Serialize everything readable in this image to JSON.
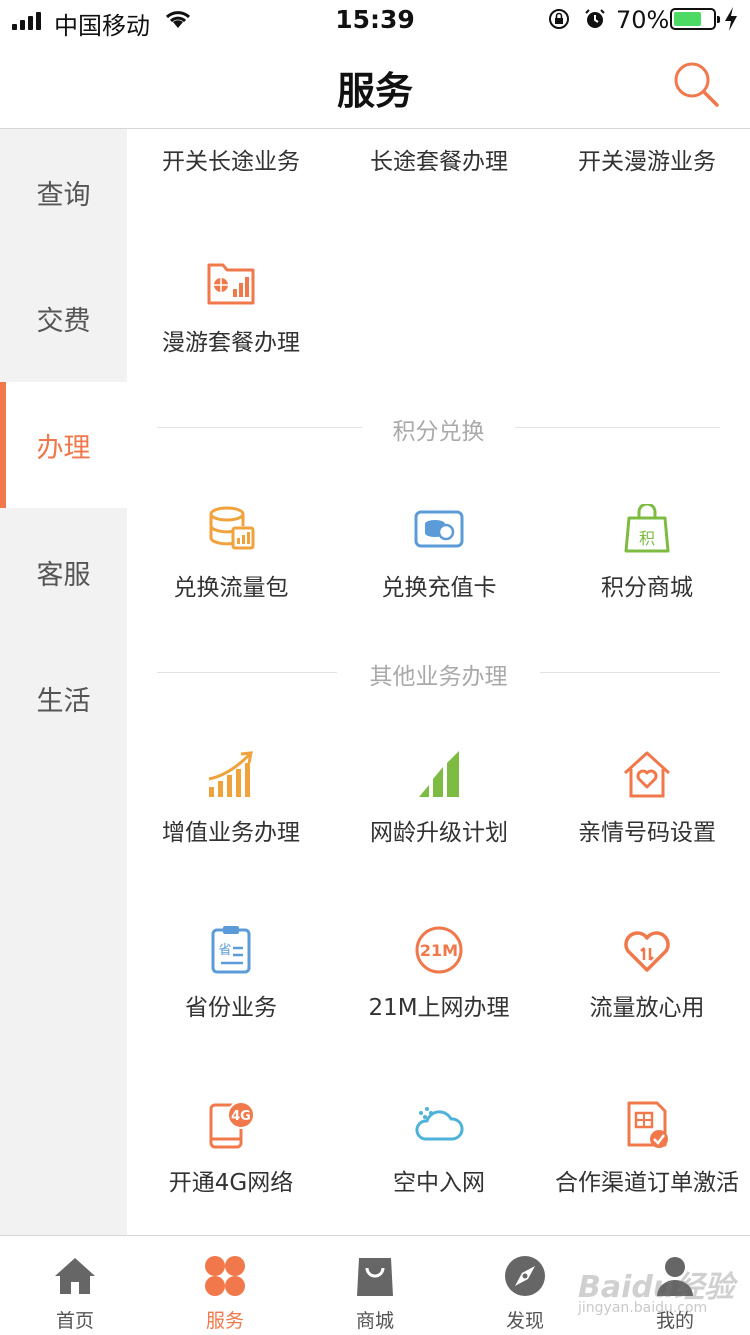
{
  "status": {
    "carrier": "中国移动",
    "time": "15:39",
    "battery_pct": "70%",
    "battery_level": 0.7
  },
  "navbar": {
    "title": "服务",
    "search_icon": "search-icon"
  },
  "sidebar": {
    "items": [
      {
        "label": "查询",
        "active": false
      },
      {
        "label": "交费",
        "active": false
      },
      {
        "label": "办理",
        "active": true
      },
      {
        "label": "客服",
        "active": false
      },
      {
        "label": "生活",
        "active": false
      }
    ]
  },
  "content": {
    "top_row": [
      "开关长途业务",
      "长途套餐办理",
      "开关漫游业务"
    ],
    "roaming": {
      "label": "漫游套餐办理",
      "icon": "roaming-package-icon"
    },
    "points_section": {
      "title": "积分兑换",
      "items": [
        {
          "label": "兑换流量包",
          "icon": "data-pack-icon"
        },
        {
          "label": "兑换充值卡",
          "icon": "recharge-card-icon"
        },
        {
          "label": "积分商城",
          "icon": "points-mall-icon"
        }
      ]
    },
    "other_section": {
      "title": "其他业务办理",
      "items": [
        {
          "label": "增值业务办理",
          "icon": "value-added-icon"
        },
        {
          "label": "网龄升级计划",
          "icon": "network-age-icon"
        },
        {
          "label": "亲情号码设置",
          "icon": "family-number-icon"
        },
        {
          "label": "省份业务",
          "icon": "province-service-icon"
        },
        {
          "label": "21M上网办理",
          "icon": "21m-internet-icon"
        },
        {
          "label": "流量放心用",
          "icon": "data-worry-free-icon"
        },
        {
          "label": "开通4G网络",
          "icon": "4g-network-icon"
        },
        {
          "label": "空中入网",
          "icon": "cloud-network-icon"
        },
        {
          "label": "合作渠道订单激活",
          "icon": "order-activation-icon"
        }
      ]
    }
  },
  "tabbar": {
    "items": [
      {
        "label": "首页",
        "icon": "home-icon"
      },
      {
        "label": "服务",
        "icon": "services-icon",
        "active": true
      },
      {
        "label": "商城",
        "icon": "shopping-bag-icon"
      },
      {
        "label": "发现",
        "icon": "compass-icon"
      },
      {
        "label": "我的",
        "icon": "profile-icon"
      }
    ]
  },
  "watermark": {
    "text": "Baidu经验",
    "sub": "jingyan.baidu.com"
  },
  "colors": {
    "accent": "#f0784b",
    "orange": "#f0a23c",
    "blue": "#5b9bd8",
    "green": "#7dbb42",
    "sidebar_bg": "#f2f2f2"
  }
}
